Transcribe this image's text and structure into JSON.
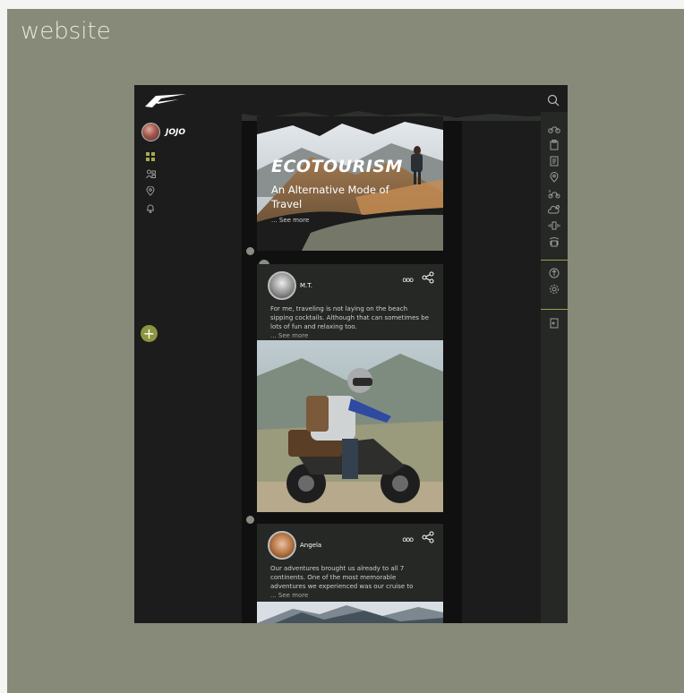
{
  "frame": {
    "label": "website"
  },
  "sidebar": {
    "username": "JOJO",
    "add_label": "+"
  },
  "hero": {
    "title": "ECOTOURISM",
    "subtitle": "An Alternative Mode of Travel",
    "more": "... See more"
  },
  "posts": [
    {
      "name": "M.T.",
      "menu": "ooo",
      "text": "For me, traveling is not laying on the beach sipping cocktails. Although that can sometimes be lots of fun and relaxing too.",
      "more": "... See more"
    },
    {
      "name": "Angela",
      "menu": "ooo",
      "text": "Our adventures brought us already to all 7 continents. One of the most memorable adventures we experienced was our cruise to",
      "more": "... See more"
    }
  ],
  "colors": {
    "frame": "#878a79",
    "app": "#1b1c1b",
    "accent": "#9da04d",
    "post": "#252825"
  },
  "icons": {
    "left_nav": [
      "grid-icon",
      "users-icon",
      "location-pin-icon",
      "bell-icon"
    ],
    "right_nav": [
      "motorcycle-icon",
      "clipboard-icon",
      "document-icon",
      "location-pin-icon",
      "route-icon",
      "weather-icon",
      "vibration-icon",
      "radio-icon",
      "upload-icon",
      "settings-icon",
      "logout-icon"
    ]
  }
}
